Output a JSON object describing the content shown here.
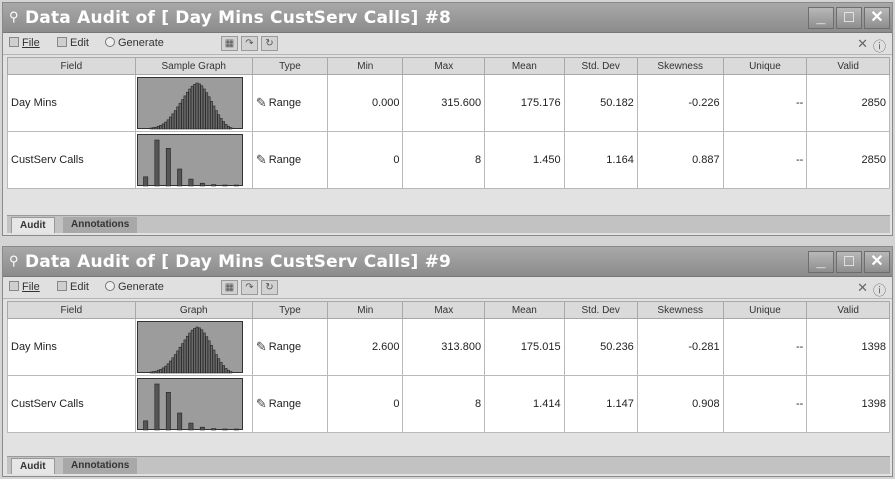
{
  "windows": [
    {
      "title": "Data Audit of [ Day Mins  CustServ Calls] #8",
      "menu": {
        "file": "File",
        "edit": "Edit",
        "generate": "Generate"
      },
      "columns": [
        "Field",
        "Sample Graph",
        "Type",
        "Min",
        "Max",
        "Mean",
        "Std. Dev",
        "Skewness",
        "Unique",
        "Valid"
      ],
      "rows": [
        {
          "field": "Day Mins",
          "type": "Range",
          "min": "0.000",
          "max": "315.600",
          "mean": "175.176",
          "std": "50.182",
          "skew": "-0.226",
          "unique": "--",
          "valid": "2850"
        },
        {
          "field": "CustServ Calls",
          "type": "Range",
          "min": "0",
          "max": "8",
          "mean": "1.450",
          "std": "1.164",
          "skew": "0.887",
          "unique": "--",
          "valid": "2850"
        }
      ],
      "tabs": [
        "Audit",
        "Annotations"
      ]
    },
    {
      "title": "Data Audit of [ Day Mins  CustServ Calls] #9",
      "menu": {
        "file": "File",
        "edit": "Edit",
        "generate": "Generate"
      },
      "columns": [
        "Field",
        "Graph",
        "Type",
        "Min",
        "Max",
        "Mean",
        "Std. Dev",
        "Skewness",
        "Unique",
        "Valid"
      ],
      "rows": [
        {
          "field": "Day Mins",
          "type": "Range",
          "min": "2.600",
          "max": "313.800",
          "mean": "175.015",
          "std": "50.236",
          "skew": "-0.281",
          "unique": "--",
          "valid": "1398"
        },
        {
          "field": "CustServ Calls",
          "type": "Range",
          "min": "0",
          "max": "8",
          "mean": "1.414",
          "std": "1.147",
          "skew": "0.908",
          "unique": "--",
          "valid": "1398"
        }
      ],
      "tabs": [
        "Audit",
        "Annotations"
      ]
    }
  ],
  "histograms": {
    "day_mins_heights": [
      0.02,
      0.03,
      0.04,
      0.06,
      0.08,
      0.11,
      0.15,
      0.2,
      0.26,
      0.33,
      0.4,
      0.48,
      0.56,
      0.64,
      0.72,
      0.8,
      0.87,
      0.93,
      0.97,
      1.0,
      0.98,
      0.94,
      0.87,
      0.79,
      0.7,
      0.6,
      0.5,
      0.4,
      0.31,
      0.23,
      0.16,
      0.1,
      0.06,
      0.03
    ],
    "custserv_heights": [
      0.2,
      1.0,
      0.82,
      0.37,
      0.15,
      0.06,
      0.03,
      0.02,
      0.01
    ]
  },
  "icons": [
    "magnifier-icon",
    "minimize-icon",
    "maximize-icon",
    "close-icon",
    "pencil-icon",
    "help-icon"
  ]
}
